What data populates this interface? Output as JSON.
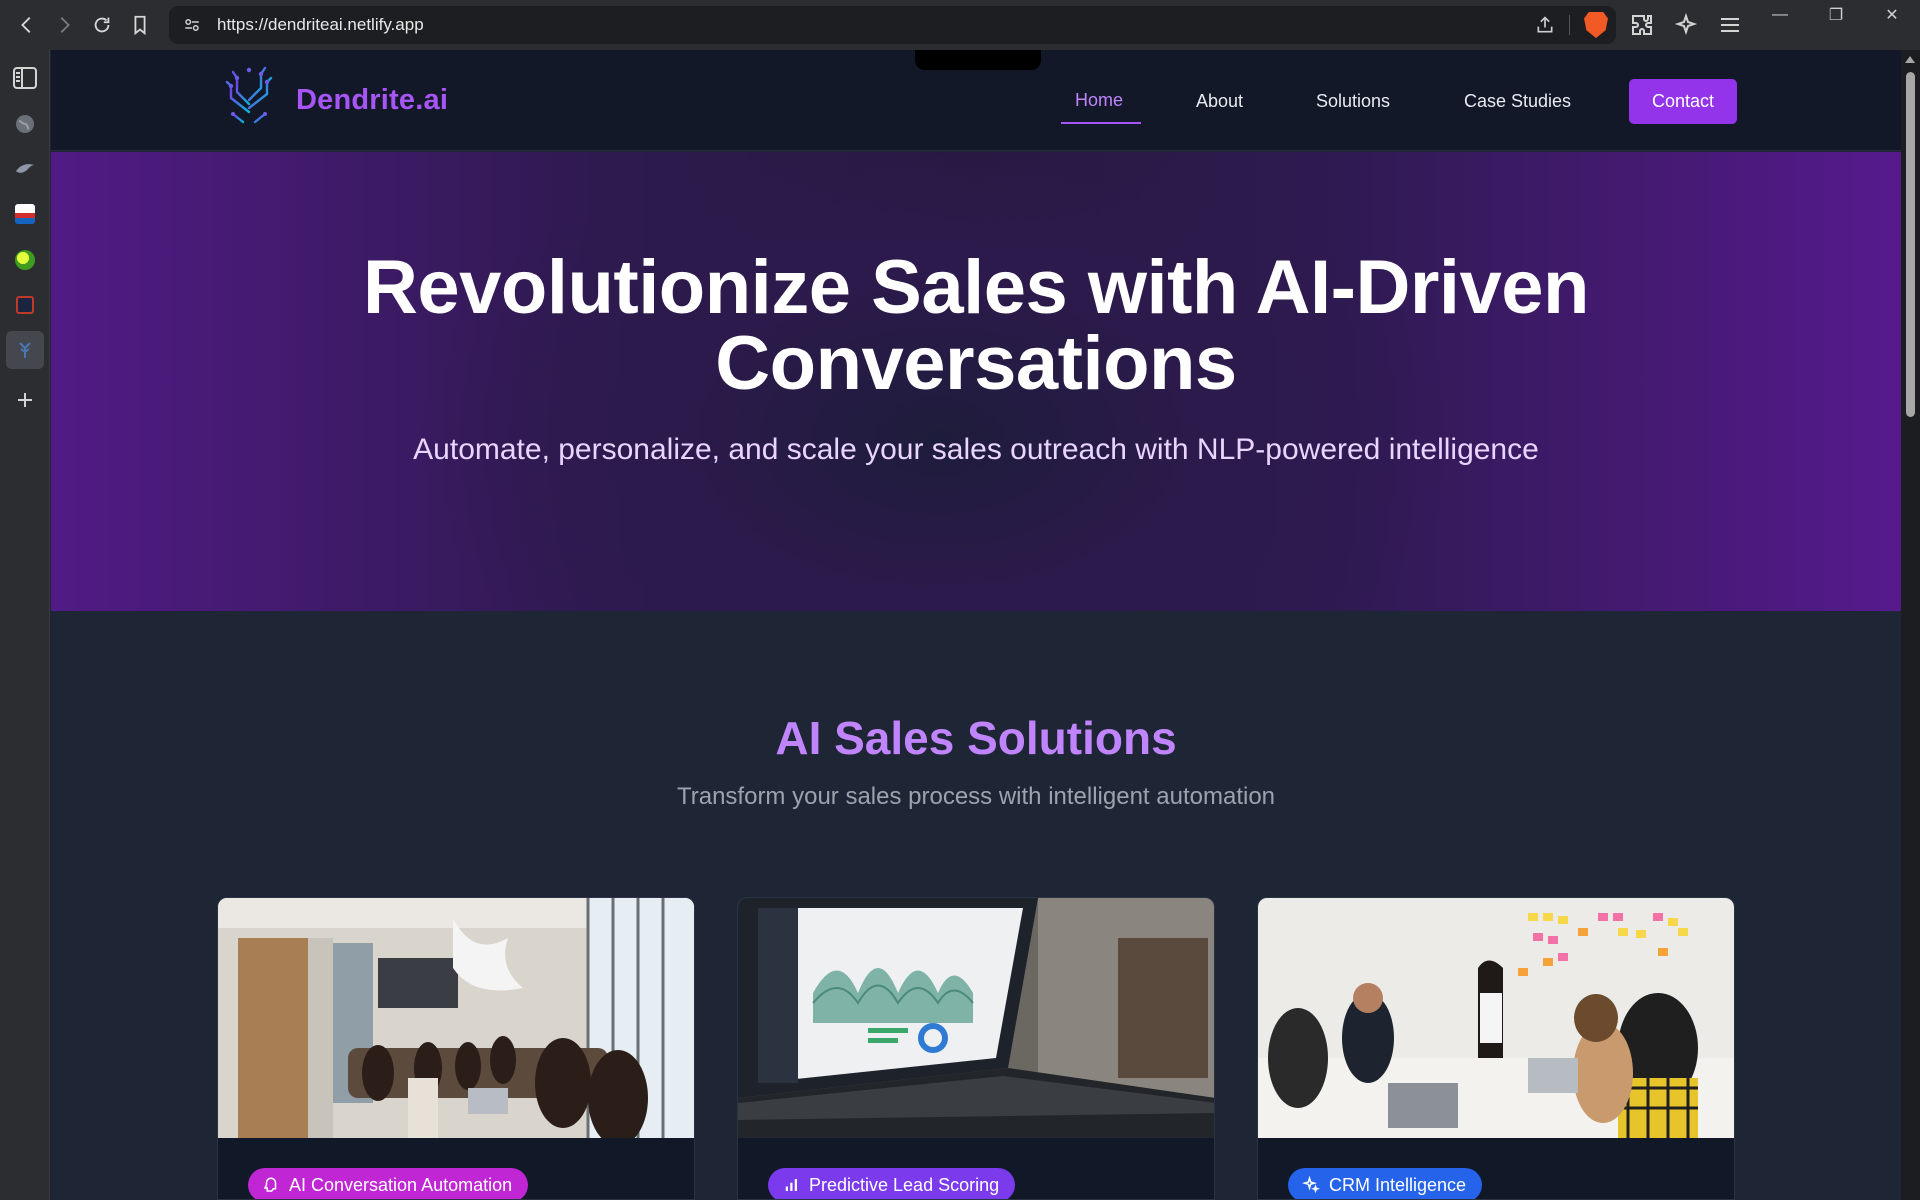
{
  "browser": {
    "url": "https://dendriteai.netlify.app"
  },
  "site": {
    "brand": "Dendrite.ai",
    "nav": {
      "home": "Home",
      "about": "About",
      "solutions": "Solutions",
      "case_studies": "Case Studies",
      "contact": "Contact"
    },
    "hero": {
      "title_line1": "Revolutionize Sales with AI-Driven",
      "title_line2": "Conversations",
      "subtitle": "Automate, personalize, and scale your sales outreach with NLP-powered intelligence"
    },
    "solutions": {
      "title": "AI Sales Solutions",
      "subtitle": "Transform your sales process with intelligent automation",
      "cards": [
        {
          "tag": "AI Conversation Automation",
          "tag_color": "#c026d3",
          "icon": "robot-icon"
        },
        {
          "tag": "Predictive Lead Scoring",
          "tag_color": "#7c3aed",
          "icon": "bar-chart-icon"
        },
        {
          "tag": "CRM Intelligence",
          "tag_color": "#2563eb",
          "icon": "sparkle-icon"
        }
      ]
    }
  },
  "colors": {
    "accent": "#a855f7",
    "contact_button": "#9333ea",
    "page_bg": "#1e2535"
  }
}
